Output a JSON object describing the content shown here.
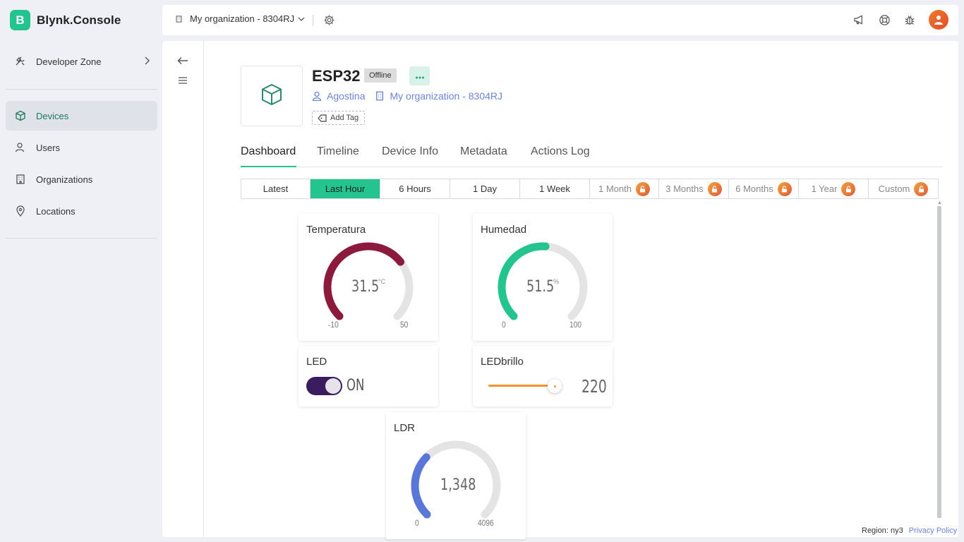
{
  "brand": {
    "letter": "B",
    "name": "Blynk.Console"
  },
  "sidebar": {
    "items": [
      {
        "label": "Developer Zone",
        "icon": "tools-icon"
      },
      {
        "label": "Devices",
        "icon": "cube-icon",
        "active": true
      },
      {
        "label": "Users",
        "icon": "users-icon"
      },
      {
        "label": "Organizations",
        "icon": "building-icon"
      },
      {
        "label": "Locations",
        "icon": "pin-icon"
      }
    ]
  },
  "topbar": {
    "org_label": "My organization - 8304RJ",
    "icons": [
      "megaphone-icon",
      "support-icon",
      "bug-icon",
      "avatar"
    ]
  },
  "device": {
    "name": "ESP32",
    "status": "Offline",
    "owner": "Agostina",
    "organization": "My organization - 8304RJ",
    "add_tag": "Add Tag"
  },
  "tabs": [
    "Dashboard",
    "Timeline",
    "Device Info",
    "Metadata",
    "Actions Log"
  ],
  "ranges": [
    {
      "label": "Latest",
      "locked": false
    },
    {
      "label": "Last Hour",
      "locked": false,
      "active": true
    },
    {
      "label": "6 Hours",
      "locked": false
    },
    {
      "label": "1 Day",
      "locked": false
    },
    {
      "label": "1 Week",
      "locked": false
    },
    {
      "label": "1 Month",
      "locked": true
    },
    {
      "label": "3 Months",
      "locked": true
    },
    {
      "label": "6 Months",
      "locked": true
    },
    {
      "label": "1 Year",
      "locked": true
    },
    {
      "label": "Custom",
      "locked": true
    }
  ],
  "widgets": {
    "temperatura": {
      "title": "Temperatura",
      "value": "31.5",
      "unit": "°C",
      "min": "-10",
      "max": "50",
      "fraction": 0.6917,
      "color": "#8b1a3c"
    },
    "humedad": {
      "title": "Humedad",
      "value": "51.5",
      "unit": "%",
      "min": "0",
      "max": "100",
      "fraction": 0.515,
      "color": "#23c48e"
    },
    "led": {
      "title": "LED",
      "state": "ON"
    },
    "ledbrillo": {
      "title": "LEDbrillo",
      "value": "220"
    },
    "ldr": {
      "title": "LDR",
      "value": "1,348",
      "min": "0",
      "max": "4096",
      "fraction": 0.3291,
      "color": "#5a76d6"
    }
  },
  "footer": {
    "region": "Region: ny3",
    "privacy": "Privacy Policy"
  },
  "colors": {
    "accent": "#23c48e",
    "link": "#6b84d6",
    "lock": "#e05a3a"
  }
}
